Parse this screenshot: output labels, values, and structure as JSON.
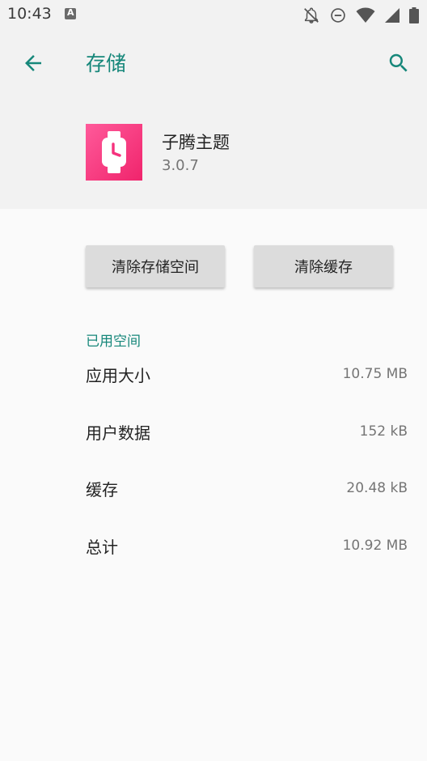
{
  "status_bar": {
    "time": "10:43",
    "notification_icon_letter": "A",
    "icons": [
      "notifications-off-icon",
      "do-not-disturb-icon",
      "wifi-icon",
      "cell-signal-icon",
      "battery-icon"
    ]
  },
  "header": {
    "title": "存储",
    "back_icon": "arrow-back-icon",
    "search_icon": "search-icon",
    "accent_color": "#16877a"
  },
  "app": {
    "name": "子腾主题",
    "version": "3.0.7",
    "icon": "watch-icon",
    "icon_color": "#f5317c"
  },
  "actions": {
    "clear_storage": "清除存储空间",
    "clear_cache": "清除缓存"
  },
  "usage": {
    "section_title": "已用空间",
    "rows": [
      {
        "label": "应用大小",
        "value": "10.75 MB"
      },
      {
        "label": "用户数据",
        "value": "152 kB"
      },
      {
        "label": "缓存",
        "value": "20.48 kB"
      },
      {
        "label": "总计",
        "value": "10.92 MB"
      }
    ]
  }
}
